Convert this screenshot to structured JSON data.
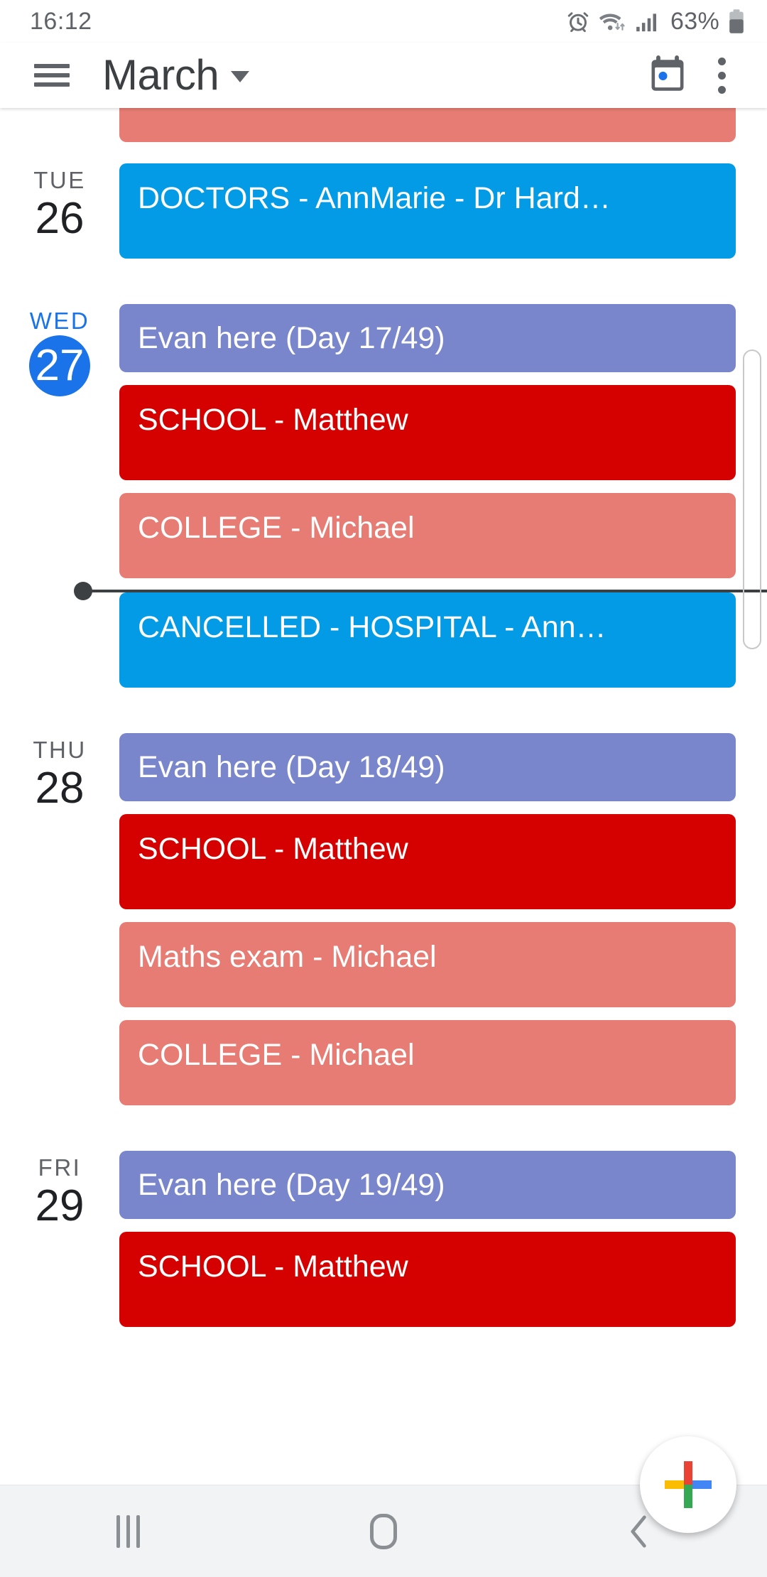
{
  "status_bar": {
    "time": "16:12",
    "battery_percent": "63%",
    "icons": [
      "alarm-icon",
      "wifi-icon",
      "signal-icon",
      "battery-icon"
    ]
  },
  "toolbar": {
    "menu_icon": "hamburger-menu-icon",
    "title": "March",
    "dropdown_icon": "chevron-down-icon",
    "today_icon": "today-calendar-icon",
    "overflow_icon": "overflow-menu-icon"
  },
  "colors": {
    "peacock_blue": "#039BE5",
    "blueberry_purple": "#7986CB",
    "tomato_red": "#D50000",
    "flamingo_salmon": "#E67C73",
    "today_blue": "#1A73E8",
    "now_line": "#3C4043"
  },
  "schedule": {
    "partial_event_top": {
      "title": "",
      "color": "#E67C73"
    },
    "days": [
      {
        "dow": "TUE",
        "day": "26",
        "is_today": false,
        "events": [
          {
            "title": "DOCTORS - AnnMarie - Dr Hard…",
            "color": "#039BE5",
            "size": "lg"
          }
        ]
      },
      {
        "dow": "WED",
        "day": "27",
        "is_today": true,
        "events": [
          {
            "title": "Evan here (Day 17/49)",
            "color": "#7986CB",
            "size": "sm"
          },
          {
            "title": "SCHOOL - Matthew",
            "color": "#D50000",
            "size": "lg"
          },
          {
            "title": "COLLEGE - Michael",
            "color": "#E67C73",
            "size": "md"
          },
          {
            "title": "CANCELLED - HOSPITAL - Ann…",
            "color": "#039BE5",
            "size": "lg"
          }
        ],
        "now_line_after_index": 2
      },
      {
        "dow": "THU",
        "day": "28",
        "is_today": false,
        "events": [
          {
            "title": "Evan here (Day 18/49)",
            "color": "#7986CB",
            "size": "sm"
          },
          {
            "title": "SCHOOL - Matthew",
            "color": "#D50000",
            "size": "lg"
          },
          {
            "title": "Maths exam - Michael",
            "color": "#E67C73",
            "size": "md"
          },
          {
            "title": "COLLEGE - Michael",
            "color": "#E67C73",
            "size": "md"
          }
        ]
      },
      {
        "dow": "FRI",
        "day": "29",
        "is_today": false,
        "events": [
          {
            "title": "Evan here (Day 19/49)",
            "color": "#7986CB",
            "size": "sm"
          },
          {
            "title": "SCHOOL - Matthew",
            "color": "#D50000",
            "size": "lg"
          }
        ]
      }
    ]
  },
  "fab": {
    "icon": "add-event-plus-icon",
    "label": "Create"
  },
  "nav_bar": {
    "recents_icon": "recents-icon",
    "home_icon": "home-icon",
    "back_icon": "back-icon"
  }
}
